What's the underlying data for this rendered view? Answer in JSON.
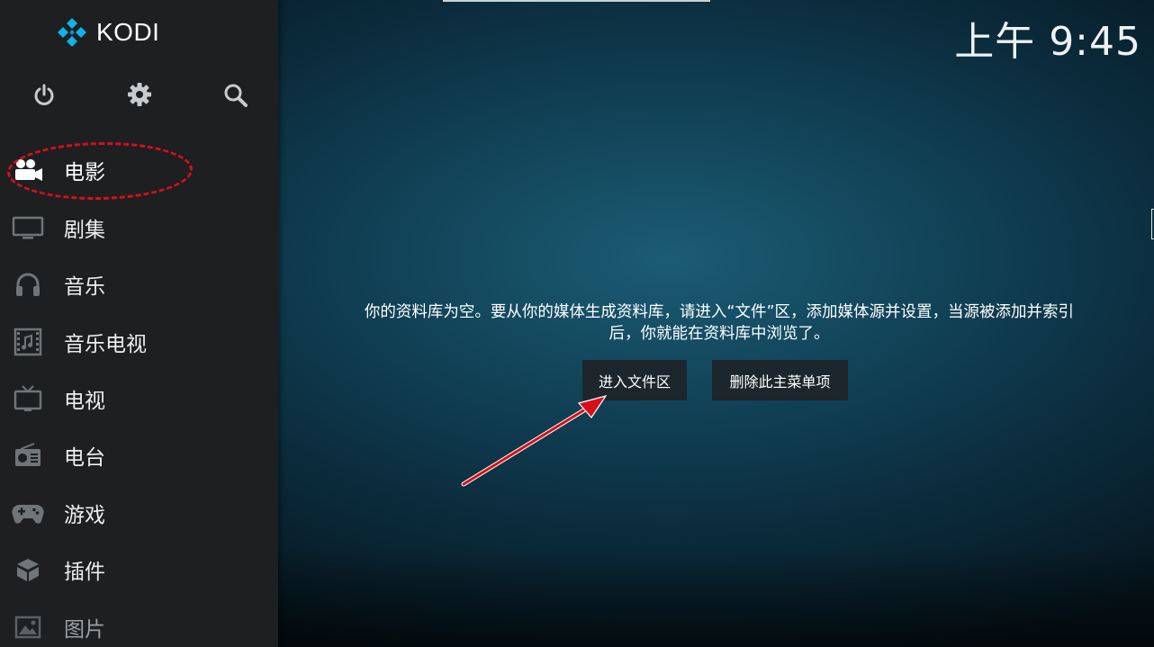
{
  "app": {
    "name": "KODI",
    "clock": "上午 9:45"
  },
  "sidebar": {
    "top_icons": [
      "power-icon",
      "gear-icon",
      "search-icon"
    ],
    "items": [
      {
        "label": "电影",
        "icon": "movie-camera-icon"
      },
      {
        "label": "剧集",
        "icon": "monitor-icon"
      },
      {
        "label": "音乐",
        "icon": "headphones-icon"
      },
      {
        "label": "音乐电视",
        "icon": "music-video-icon"
      },
      {
        "label": "电视",
        "icon": "tv-icon"
      },
      {
        "label": "电台",
        "icon": "radio-icon"
      },
      {
        "label": "游戏",
        "icon": "gamepad-icon"
      },
      {
        "label": "插件",
        "icon": "addons-box-icon"
      },
      {
        "label": "图片",
        "icon": "picture-icon"
      }
    ]
  },
  "main": {
    "message_line1": "你的资料库为空。要从你的媒体生成资料库，请进入“文件”区，添加媒体源并设置，当源被添加并索引",
    "message_line2": "后，你就能在资料库中浏览了。",
    "enter_files_button": "进入文件区",
    "remove_item_button": "删除此主菜单项"
  },
  "colors": {
    "sidebar_bg": "#1e1f21",
    "accent_blue": "#12b2e7",
    "annotation_red": "#d6101a",
    "button_bg": "#1c262c"
  }
}
